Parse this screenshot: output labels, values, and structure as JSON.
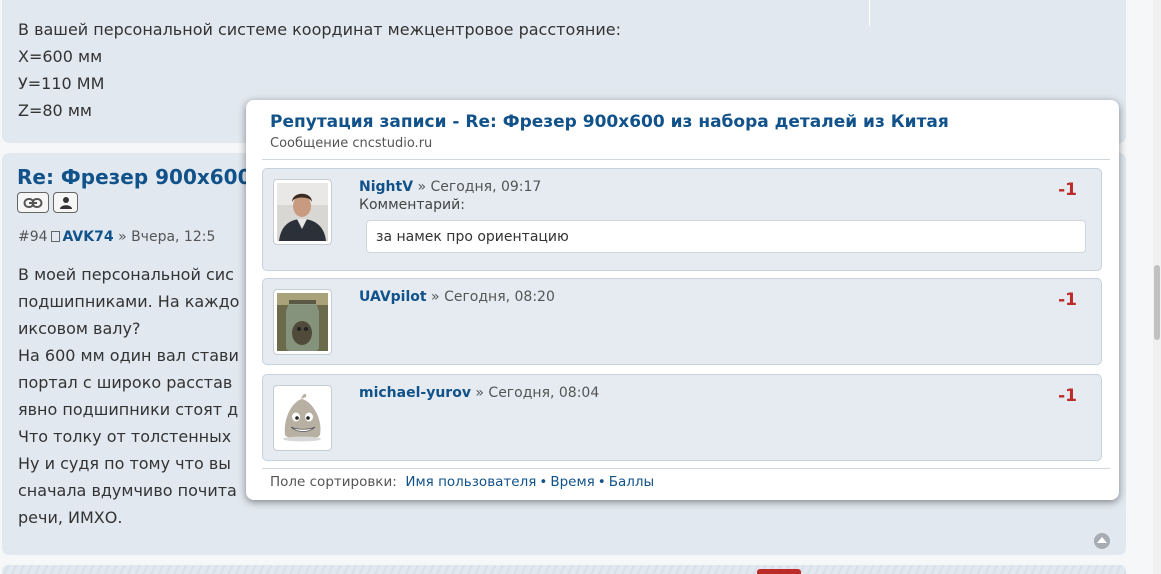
{
  "post_prev": {
    "lines": [
      "В вашей персональной системе координат межцентровое расстояние:",
      "X=600 мм",
      "У=110 ММ",
      "Z=80 мм"
    ]
  },
  "post": {
    "title": "Re: Фрезер 900х600",
    "number": "#94",
    "author": "AVK74",
    "date": "» Вчера, 12:5",
    "lines": [
      "В моей персональной сис",
      "подшипниками. На каждо",
      "иксовом валу?",
      "На 600 мм один вал стави",
      "портал с широко расстав",
      "явно подшипники стоят д",
      "Что толку от толстенных",
      "Ну и судя по тому что вы",
      "сначала вдумчиво почита",
      "речи, ИМХО."
    ]
  },
  "popup": {
    "title": "Репутация записи - Re: Фрезер 900х600 из набора деталей из Китая",
    "subtitle": "Сообщение cncstudio.ru",
    "items": [
      {
        "user": "NightV",
        "date": "» Сегодня, 09:17",
        "comment_label": "Комментарий:",
        "comment": "за намек про ориентацию",
        "points": "-1"
      },
      {
        "user": "UAVpilot",
        "date": "» Сегодня, 08:20",
        "points": "-1"
      },
      {
        "user": "michael-yurov",
        "date": "» Сегодня, 08:04",
        "points": "-1"
      }
    ],
    "sort": {
      "label": "Поле сортировки:",
      "options": [
        "Имя пользователя",
        "Время",
        "Баллы"
      ],
      "separator": "•"
    }
  },
  "colors": {
    "link": "#105289",
    "negative": "#bc2a2a",
    "post_bg": "#e1e8ef",
    "item_bg": "#e5ebf1"
  }
}
